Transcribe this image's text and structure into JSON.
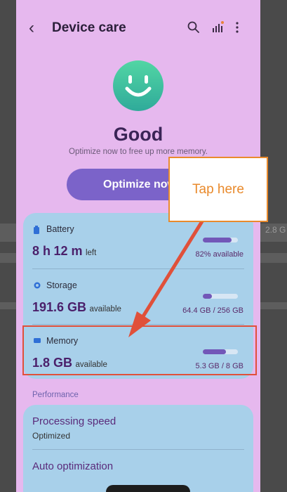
{
  "header": {
    "title": "Device care"
  },
  "status": {
    "label": "Good",
    "subtitle": "Optimize now to free up more memory."
  },
  "optimize_button": {
    "label": "Optimize now"
  },
  "resources": {
    "battery": {
      "label": "Battery",
      "h": "8 h",
      "m": "12 m",
      "suffix": "left",
      "available": "82% available",
      "fill_fraction": 0.82
    },
    "storage": {
      "label": "Storage",
      "value": "191.6 GB",
      "suffix": "available",
      "used": "64.4 GB / 256 GB",
      "fill_fraction": 0.25
    },
    "memory": {
      "label": "Memory",
      "value": "1.8 GB",
      "suffix": "available",
      "used": "5.3 GB / 8 GB",
      "fill_fraction": 0.66
    }
  },
  "performance": {
    "section_label": "Performance",
    "processing_speed": {
      "title": "Processing speed",
      "value": "Optimized"
    },
    "auto_optimization": {
      "title": "Auto optimization"
    }
  },
  "annotation": {
    "callout_text": "Tap here"
  },
  "background": {
    "right_text": "2.8 G"
  },
  "colors": {
    "accent": "#7b63c9",
    "highlight_border": "#e0503a",
    "callout": "#e98a2c",
    "arrow": "#e0503a"
  }
}
